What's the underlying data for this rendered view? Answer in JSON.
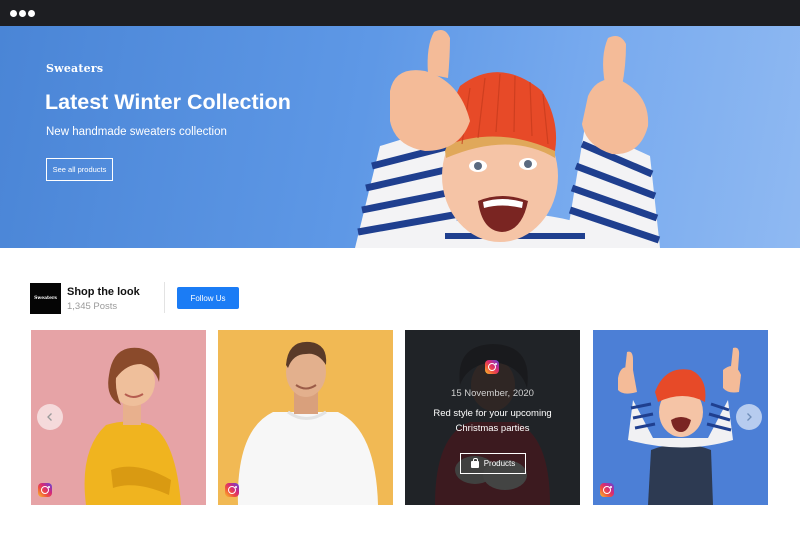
{
  "hero": {
    "brand": "Sweaters",
    "title": "Latest Winter Collection",
    "subtitle": "New handmade sweaters collection",
    "cta_label": "See all products"
  },
  "profile": {
    "avatar_text": "Sweaters",
    "name": "Shop the look",
    "posts": "1,345 Posts",
    "follow_label": "Follow Us"
  },
  "feed": {
    "cards": [
      {
        "subject": "woman in yellow sweater",
        "has_instagram_badge": true
      },
      {
        "subject": "man in white sweater",
        "has_instagram_badge": true
      },
      {
        "subject": "woman in red sweater",
        "overlay": {
          "date": "15 November, 2020",
          "text": "Red style for your upcoming Christmas parties",
          "button_label": "Products"
        }
      },
      {
        "subject": "child giving thumbs up",
        "has_instagram_badge": true
      }
    ]
  },
  "colors": {
    "hero_blue": "#4a85d6",
    "follow_blue": "#1b7cf5",
    "chrome": "#1d1e22"
  }
}
